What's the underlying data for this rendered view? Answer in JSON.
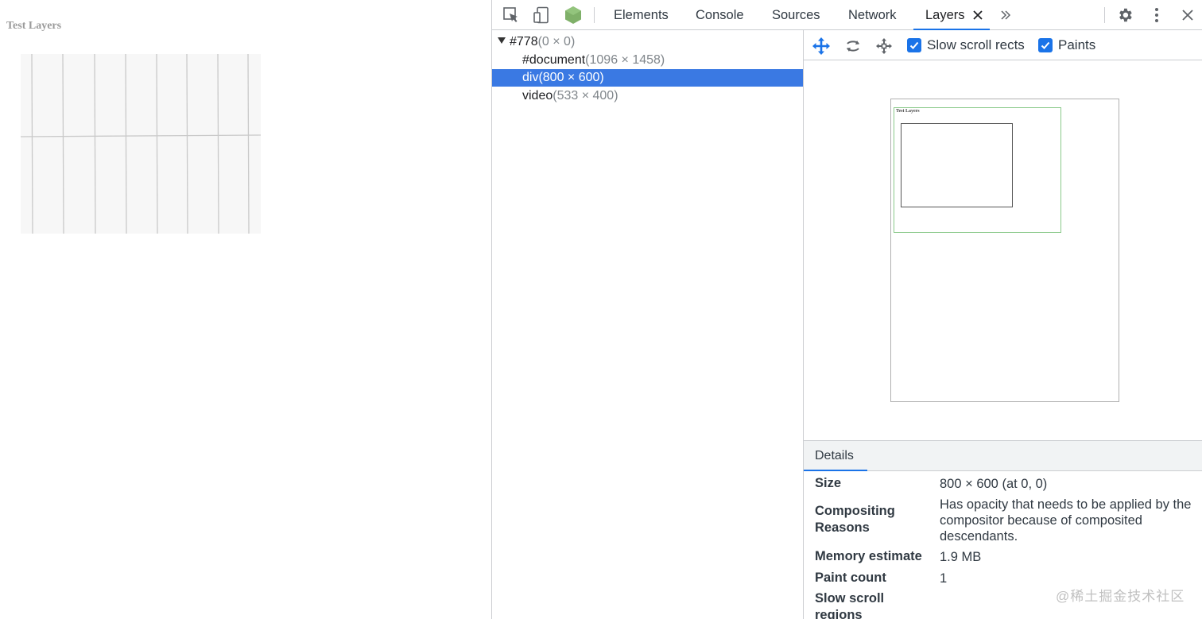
{
  "page": {
    "title": "Test Layers"
  },
  "devtools": {
    "toolbar": {
      "tabs": [
        {
          "label": "Elements"
        },
        {
          "label": "Console"
        },
        {
          "label": "Sources"
        },
        {
          "label": "Network"
        },
        {
          "label": "Layers",
          "active": true
        }
      ],
      "icons": [
        "inspect-element-icon",
        "device-toolbar-icon",
        "node-icon",
        "more-tabs-icon",
        "settings-icon",
        "kebab-menu-icon",
        "close-devtools-icon"
      ]
    },
    "layer_tree": [
      {
        "name": "#778",
        "size": "(0 × 0)",
        "expanded": true,
        "indent": 0
      },
      {
        "name": "#document",
        "size": "(1096 × 1458)",
        "indent": 1
      },
      {
        "name": "div",
        "size": "(800 × 600)",
        "indent": 1,
        "selected": true
      },
      {
        "name": "video",
        "size": "(533 × 400)",
        "indent": 1
      }
    ],
    "viewer_toolbar": {
      "icons": [
        "pan-mode-icon",
        "rotate-mode-icon",
        "reset-transform-icon"
      ],
      "checkboxes": [
        {
          "label": "Slow scroll rects",
          "checked": true
        },
        {
          "label": "Paints",
          "checked": true
        }
      ]
    },
    "viewer": {
      "doc_title": "Test Layers"
    },
    "details": {
      "tab": "Details",
      "rows": [
        {
          "key": "Size",
          "value": "800 × 600 (at 0, 0)"
        },
        {
          "key": "Compositing Reasons",
          "value": "Has opacity that needs to be applied by the compositor because of composited descendants."
        },
        {
          "key": "Memory estimate",
          "value": "1.9 MB"
        },
        {
          "key": "Paint count",
          "value": "1"
        },
        {
          "key": "Slow scroll regions",
          "value": ""
        }
      ]
    },
    "colors": {
      "accent": "#1a73e8",
      "selection": "#3a79e3",
      "border": "#cbcdd1"
    }
  },
  "watermark": "@稀土掘金技术社区"
}
